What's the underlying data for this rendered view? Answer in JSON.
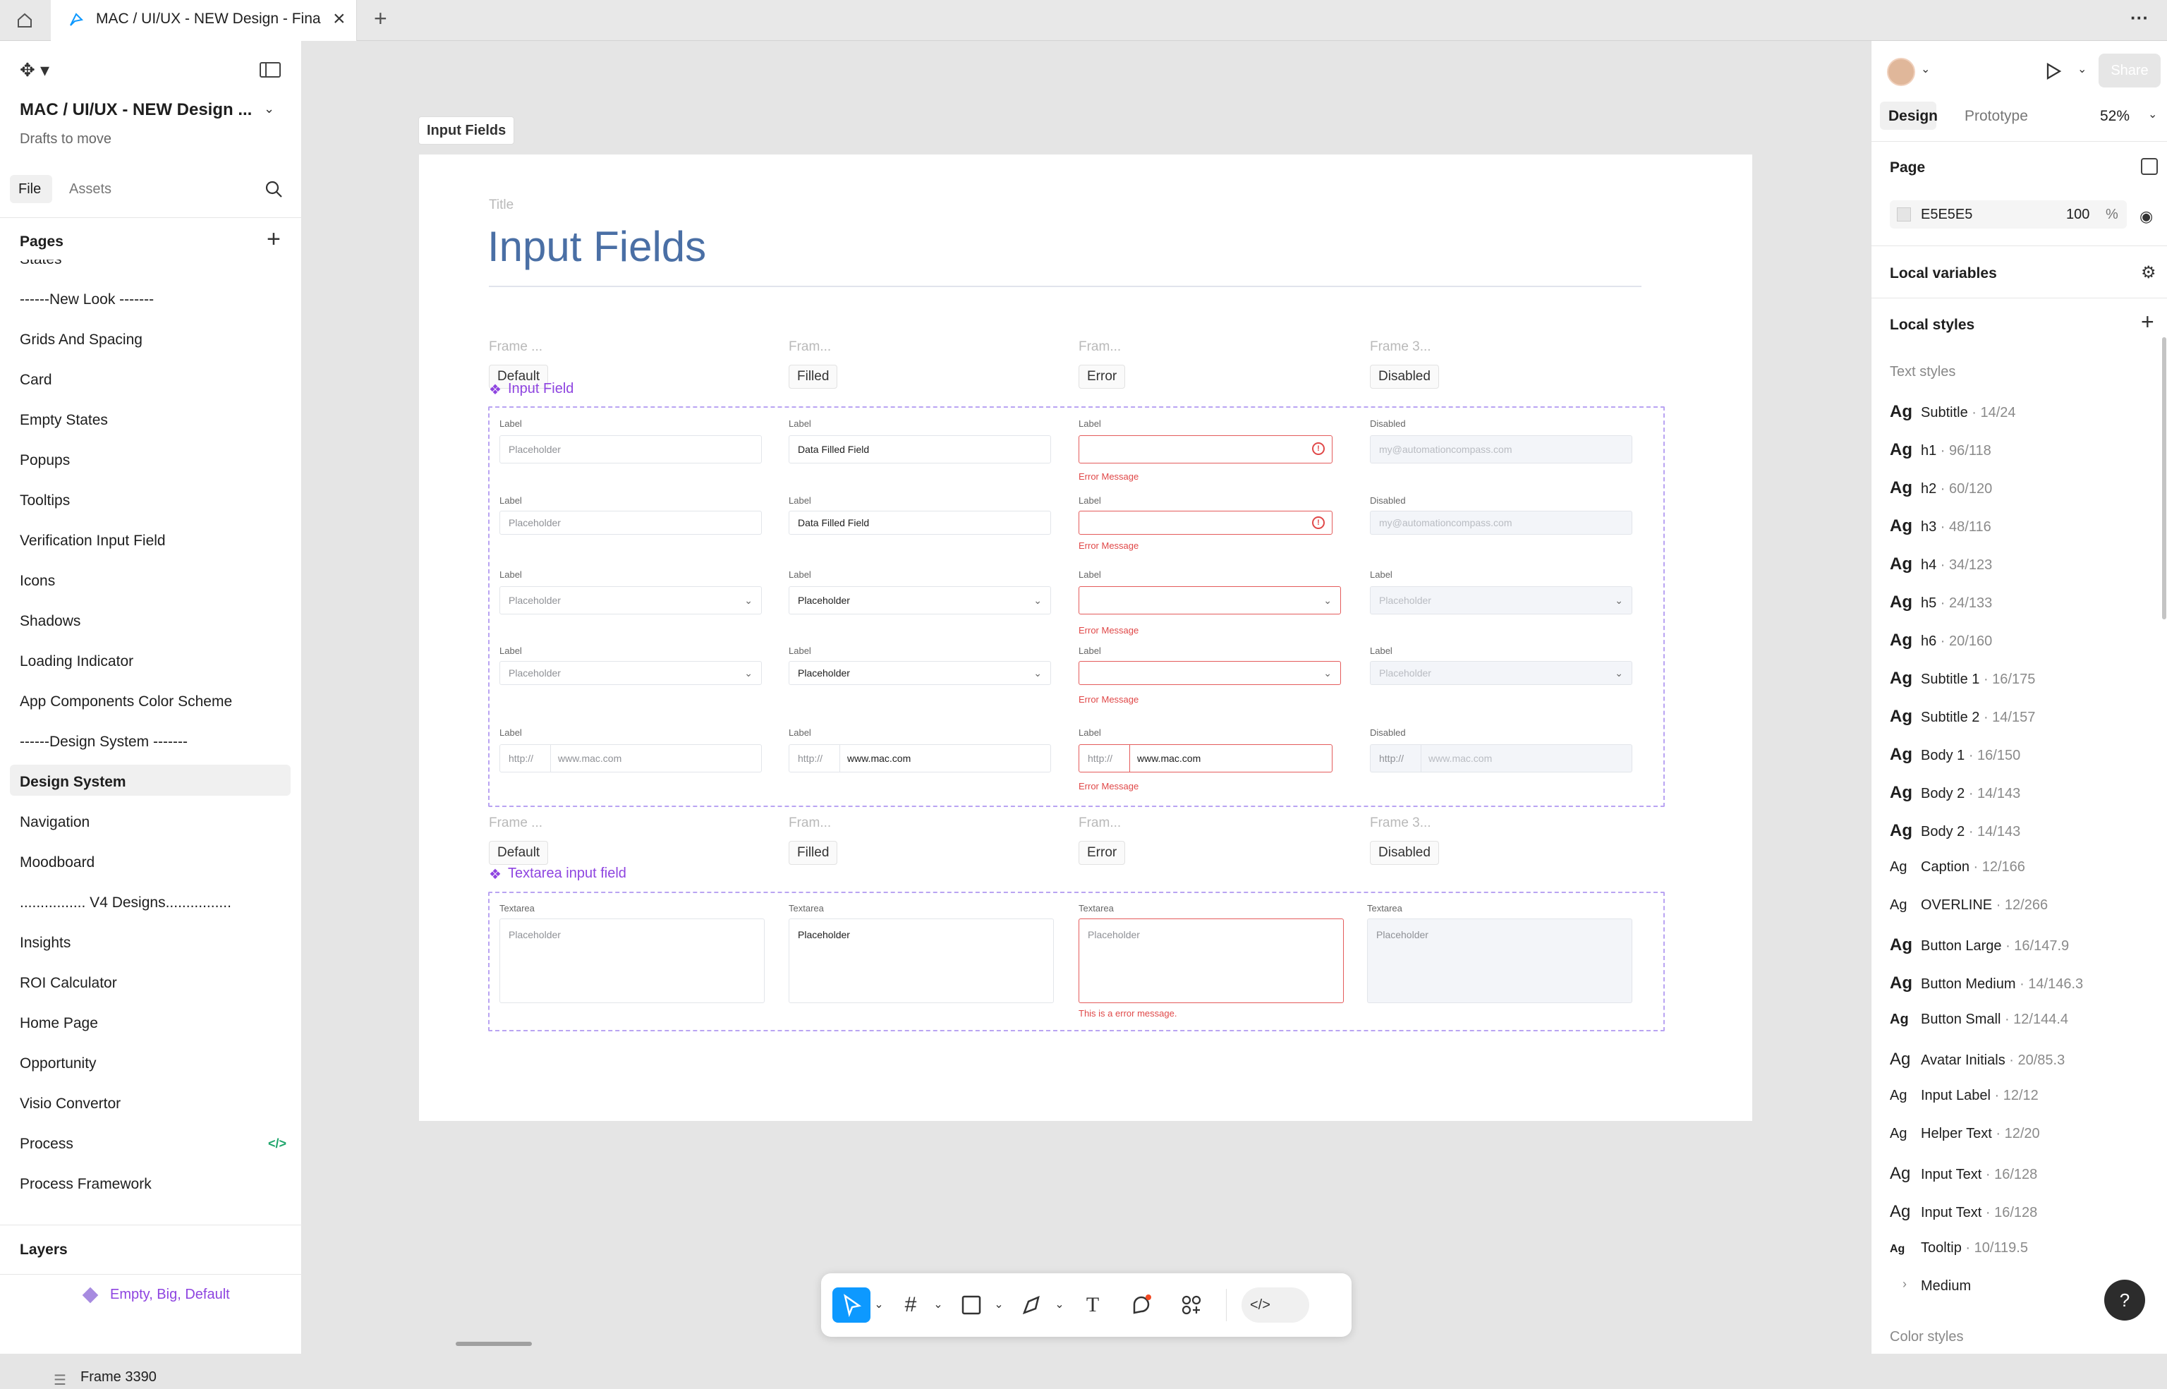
{
  "topbar": {
    "tab_title": "MAC / UI/UX - NEW Design - Fina",
    "more_label": "···"
  },
  "left_panel": {
    "file_title": "MAC / UI/UX - NEW Design ...",
    "subtitle": "Drafts to move",
    "tabs": [
      "File",
      "Assets"
    ],
    "pages_header": "Pages",
    "pages": [
      "States",
      "------New Look -------",
      "Grids And Spacing",
      "Card",
      "Empty States",
      "Popups",
      "Tooltips",
      "Verification Input Field",
      "Icons",
      "Shadows",
      "Loading Indicator",
      "App Components Color Scheme",
      "------Design System -------",
      "Design System",
      "Navigation",
      "Moodboard",
      "................ V4 Designs................",
      "Insights",
      "ROI Calculator",
      "Home Page",
      "Opportunity",
      "Visio Convertor",
      "Process",
      "Process Framework"
    ],
    "selected_page": "Design System",
    "code_badge": "</>",
    "layers_header": "Layers",
    "layers": [
      "Empty, Big, Default",
      "Frame 3390"
    ]
  },
  "canvas": {
    "frame_label": "Input Fields",
    "title_small": "Title",
    "title": "Input Fields",
    "frame_names_grey": [
      "Frame ...",
      "Fram...",
      "Fram...",
      "Frame 3..."
    ],
    "state_badges": [
      "Default",
      "Filled",
      "Error",
      "Disabled"
    ],
    "component_input": "Input Field",
    "component_textarea": "Textarea input field",
    "field_label": "Label",
    "disabled_label": "Disabled",
    "placeholder": "Placeholder",
    "filled_value": "Data Filled Field",
    "disabled_email": "my@automationcompass.com",
    "error_message": "Error Message",
    "url_prefix": "http://",
    "url_value": "www.mac.com",
    "textarea_label": "Textarea",
    "textarea_error": "This is a error message."
  },
  "right_panel": {
    "tabs": [
      "Design",
      "Prototype"
    ],
    "zoom": "52%",
    "share": "Share",
    "page_header": "Page",
    "page_color": "E5E5E5",
    "page_opacity": "100",
    "percent": "%",
    "local_variables": "Local variables",
    "local_styles": "Local styles",
    "text_styles_header": "Text styles",
    "text_styles": [
      {
        "name": "Subtitle",
        "size": " · 14/24"
      },
      {
        "name": "h1",
        "size": " · 96/118"
      },
      {
        "name": "h2",
        "size": " · 60/120"
      },
      {
        "name": "h3",
        "size": " · 48/116"
      },
      {
        "name": "h4",
        "size": " · 34/123"
      },
      {
        "name": "h5",
        "size": " · 24/133"
      },
      {
        "name": "h6",
        "size": " · 20/160"
      },
      {
        "name": "Subtitle 1",
        "size": " · 16/175"
      },
      {
        "name": "Subtitle 2",
        "size": " · 14/157"
      },
      {
        "name": "Body 1",
        "size": " · 16/150"
      },
      {
        "name": "Body 2",
        "size": " · 14/143"
      },
      {
        "name": "Body 2",
        "size": " · 14/143"
      },
      {
        "name": "Caption",
        "size": " · 12/166"
      },
      {
        "name": "OVERLINE",
        "size": " · 12/266"
      },
      {
        "name": "Button Large",
        "size": " · 16/147.9"
      },
      {
        "name": "Button Medium",
        "size": " · 14/146.3"
      },
      {
        "name": "Button Small",
        "size": " · 12/144.4"
      },
      {
        "name": "Avatar Initials",
        "size": " · 20/85.3"
      },
      {
        "name": "Input Label",
        "size": " · 12/12"
      },
      {
        "name": "Helper Text",
        "size": " · 12/20"
      },
      {
        "name": "Input Text",
        "size": " · 16/128"
      },
      {
        "name": "Input Text",
        "size": " · 16/128"
      },
      {
        "name": "Tooltip",
        "size": " · 10/119.5"
      }
    ],
    "ag": "Ag",
    "medium_group": "Medium",
    "color_styles": "Color styles"
  },
  "colors": {
    "accent": "#0d99ff",
    "component": "#8e44e0",
    "error": "#e04848",
    "title_blue": "#4a6fa5"
  },
  "help_label": "?"
}
